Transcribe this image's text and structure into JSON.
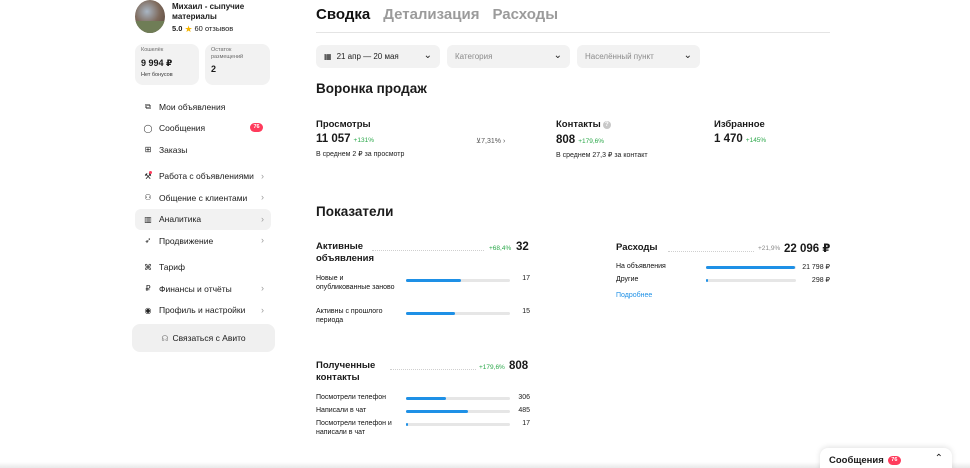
{
  "profile": {
    "name": "Михаил - сыпучие материалы",
    "rating": "5.0",
    "reviews": "60 отзывов"
  },
  "wallet": {
    "label": "Кошелёк",
    "value": "9 994 ₽",
    "sub": "Нет бонусов"
  },
  "placements": {
    "label": "Остаток размещений",
    "value": "2"
  },
  "nav": {
    "my_ads": "Мои объявления",
    "messages": "Сообщения",
    "messages_badge": "76",
    "orders": "Заказы",
    "ads_work": "Работа с объявлениями",
    "clients": "Общение с клиентами",
    "analytics": "Аналитика",
    "promotion": "Продвижение",
    "tariff": "Тариф",
    "finance": "Финансы и отчёты",
    "profile": "Профиль и настройки"
  },
  "contact_avito": "Связаться с Авито",
  "tabs": [
    "Сводка",
    "Детализация",
    "Расходы"
  ],
  "filters": {
    "date": "21 апр — 20 мая",
    "category": "Категория",
    "city": "Населённый пункт"
  },
  "funnel": {
    "title": "Воронка продаж",
    "views": {
      "title": "Просмотры",
      "value": "11 057",
      "pct": "+131%",
      "note": "В среднем 2 ₽ за просмотр",
      "conversion": "7,31%"
    },
    "contacts": {
      "title": "Контакты",
      "value": "808",
      "pct": "+179,6%",
      "note": "В среднем 27,3 ₽ за контакт"
    },
    "favorites": {
      "title": "Избранное",
      "value": "1 470",
      "pct": "+145%"
    }
  },
  "indicators": {
    "title": "Показатели",
    "active_ads": {
      "title": "Активные объявления",
      "pct": "+68,4%",
      "value": "32",
      "rows": [
        {
          "label": "Новые и опубликованные заново",
          "value": "17",
          "fill": 0.53
        },
        {
          "label": "Активны с прошлого периода",
          "value": "15",
          "fill": 0.47
        }
      ]
    },
    "expenses": {
      "title": "Расходы",
      "pct": "+21,9%",
      "value": "22 096 ₽",
      "rows": [
        {
          "label": "На объявления",
          "value": "21 798 ₽",
          "fill": 0.99
        },
        {
          "label": "Другие",
          "value": "298 ₽",
          "fill": 0.02
        }
      ],
      "more": "Подробнее"
    },
    "contacts_received": {
      "title": "Полученные контакты",
      "pct": "+179,6%",
      "value": "808",
      "rows": [
        {
          "label": "Посмотрели телефон",
          "value": "306",
          "fill": 0.38
        },
        {
          "label": "Написали в чат",
          "value": "485",
          "fill": 0.6
        },
        {
          "label": "Посмотрели телефон и написали в чат",
          "value": "17",
          "fill": 0.02
        }
      ]
    }
  },
  "messages_widget": {
    "label": "Сообщения",
    "badge": "76"
  },
  "colors": {
    "accent": "#1e90e6",
    "positive": "#2ba84a",
    "badge": "#ff3b5c"
  }
}
